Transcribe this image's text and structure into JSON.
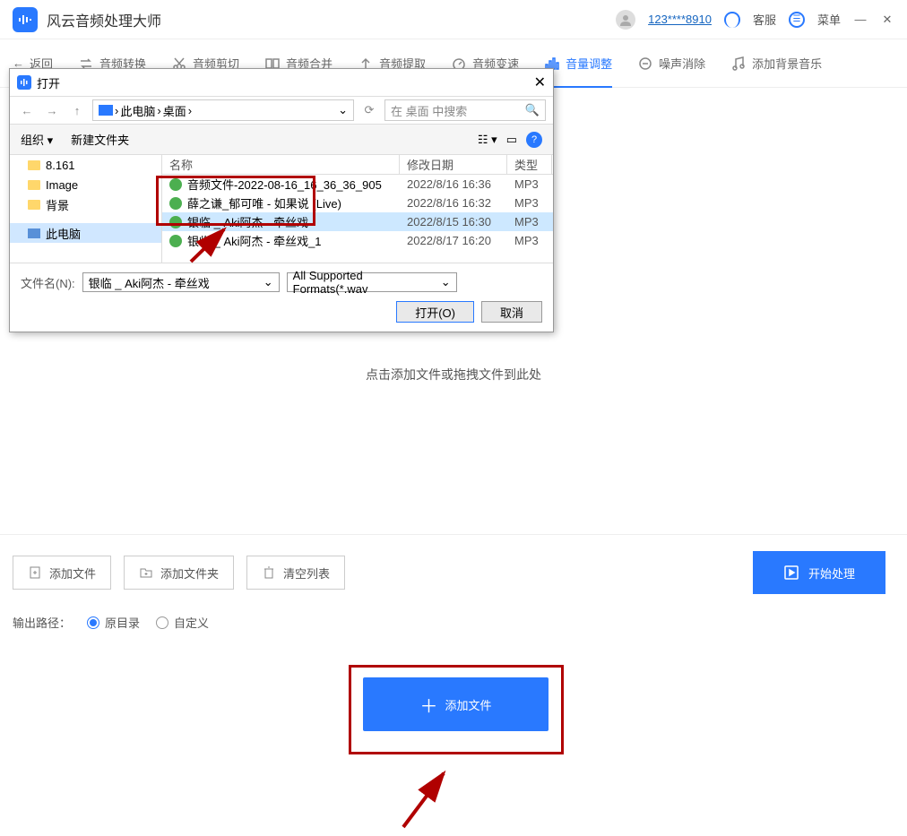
{
  "app": {
    "title": "风云音频处理大师"
  },
  "titlebar": {
    "user": "123****8910",
    "support": "客服",
    "menu": "菜单"
  },
  "tabs": {
    "back": "返回",
    "convert": "音频转换",
    "cut": "音频剪切",
    "merge": "音频合并",
    "extract": "音频提取",
    "speed": "音频变速",
    "volume": "音量调整",
    "noise": "噪声消除",
    "bgmusic": "添加背景音乐"
  },
  "main": {
    "hint": "点击添加文件或拖拽文件到此处",
    "addFile": "添加文件"
  },
  "bottom": {
    "addFile": "添加文件",
    "addFolder": "添加文件夹",
    "clear": "清空列表",
    "start": "开始处理",
    "outputLabel": "输出路径：",
    "origDir": "原目录",
    "custom": "自定义"
  },
  "dialog": {
    "title": "打开",
    "pathPc": "此电脑",
    "pathDesktop": "桌面",
    "searchPlaceholder": "在 桌面 中搜索",
    "organize": "组织",
    "newFolder": "新建文件夹",
    "tree": {
      "f1": "8.161",
      "f2": "Image",
      "f3": "背景",
      "pc": "此电脑"
    },
    "columns": {
      "name": "名称",
      "date": "修改日期",
      "type": "类型"
    },
    "files": [
      {
        "name": "音频文件-2022-08-16_16_36_36_905",
        "date": "2022/8/16 16:36",
        "type": "MP3"
      },
      {
        "name": "薛之谦_郁可唯 - 如果说 (Live)",
        "date": "2022/8/16 16:32",
        "type": "MP3"
      },
      {
        "name": "银临 _ Aki阿杰 - 牵丝戏",
        "date": "2022/8/15 16:30",
        "type": "MP3"
      },
      {
        "name": "银临 _ Aki阿杰 - 牵丝戏_1",
        "date": "2022/8/17 16:20",
        "type": "MP3"
      }
    ],
    "fileNameLabel": "文件名(N):",
    "fileNameValue": "银临 _ Aki阿杰 - 牵丝戏",
    "formatFilter": "All Supported Formats(*.wav",
    "openBtn": "打开(O)",
    "cancelBtn": "取消"
  }
}
